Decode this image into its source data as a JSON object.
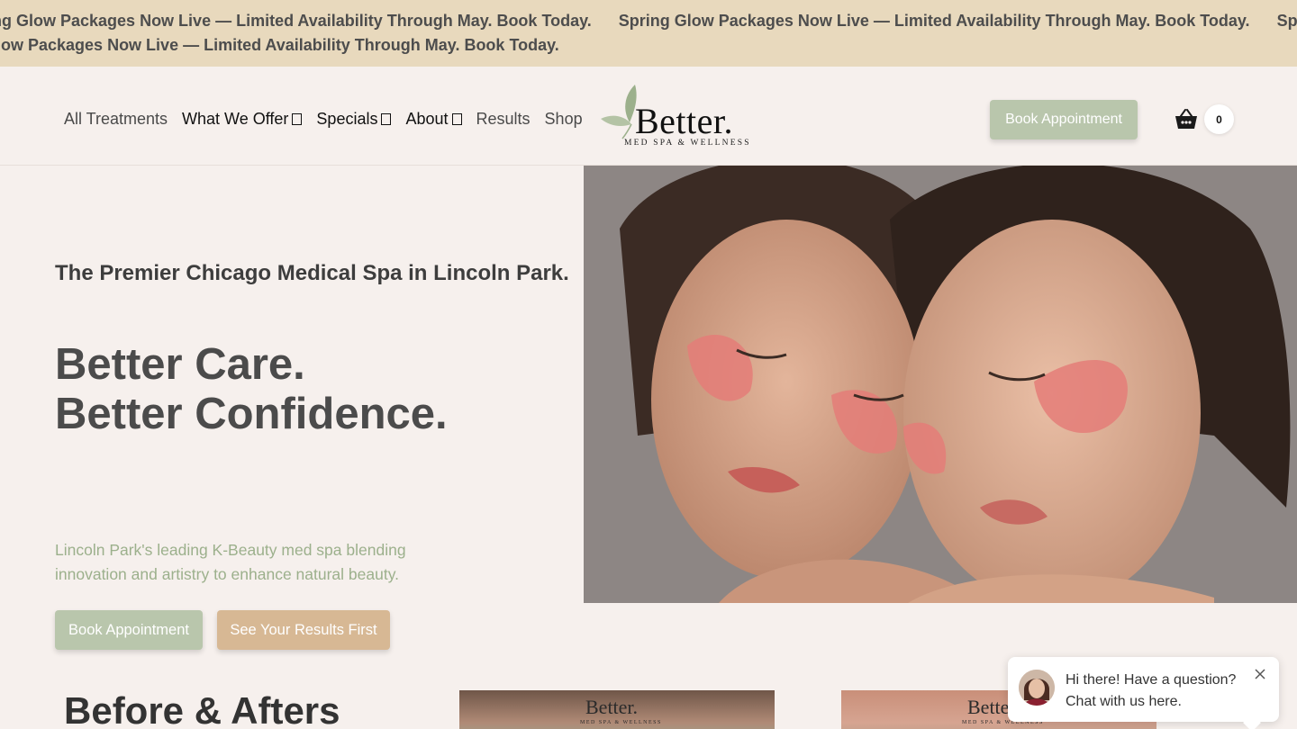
{
  "announcement": {
    "segment_1": "Spring Glow Packages Now Live — Limited Availability Through May. Book Today.",
    "segment_2": "Spring Glow Packages Now Live — Limited Availability Through May. Book Today.",
    "segment_3": "Spring Glow Packages Now Live — Limited Availability Through May. Book Today.",
    "line2_segment": "Spring Glow Packages Now Live — Limited Availability Through May. Book Today."
  },
  "nav": {
    "items": [
      {
        "label": "All Treatments"
      },
      {
        "label": "What We Offer"
      },
      {
        "label": "Specials"
      },
      {
        "label": "About"
      },
      {
        "label": "Results"
      },
      {
        "label": "Shop"
      }
    ]
  },
  "logo": {
    "wordmark": "Better.",
    "tagline": "MED SPA & WELLNESS"
  },
  "header": {
    "book_label": "Book Appointment",
    "cart_count": "0"
  },
  "hero": {
    "eyebrow": "The Premier Chicago Medical Spa in Lincoln Park.",
    "headline_line1": "Better Care.",
    "headline_line2": "Better Confidence.",
    "description": "Lincoln Park's leading K-Beauty med spa blending innovation and artistry to enhance natural beauty.",
    "primary_cta": "Book Appointment",
    "secondary_cta": "See Your Results First"
  },
  "before_after": {
    "title": "Before & Afters",
    "thumb_logo": "Better.",
    "thumb_tagline": "MED SPA & WELLNESS"
  },
  "chat": {
    "line1": "Hi there! Have a question?",
    "line2": "Chat with us here."
  },
  "colors": {
    "page_bg": "#f6f0ed",
    "announcement_bg": "#e8d9bd",
    "sage": "#b9c6ac",
    "tan": "#d7b894",
    "description_text": "#9cb08c"
  },
  "icons": {
    "cart": "basket-icon",
    "chat_close": "close-icon",
    "logo_mark": "leaf-icon",
    "dropdown": "chevron-down-icon"
  }
}
